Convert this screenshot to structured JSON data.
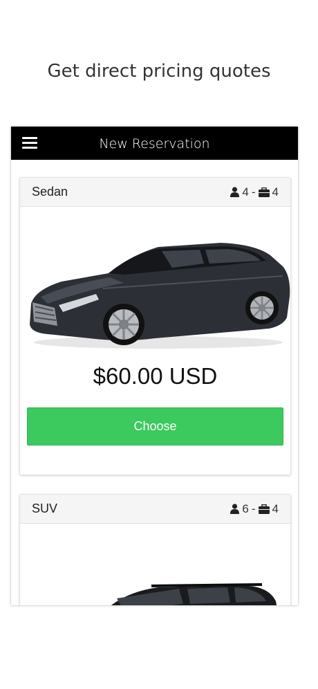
{
  "headline": "Get direct pricing quotes",
  "topbar": {
    "title": "New Reservation"
  },
  "vehicles": [
    {
      "name": "Sedan",
      "passengers": "4",
      "separator": "-",
      "luggage": "4",
      "price": "$60.00 USD",
      "action": "Choose"
    },
    {
      "name": "SUV",
      "passengers": "6",
      "separator": "-",
      "luggage": "4"
    }
  ],
  "colors": {
    "topbar": "#000000",
    "accent": "#3cc95e"
  }
}
